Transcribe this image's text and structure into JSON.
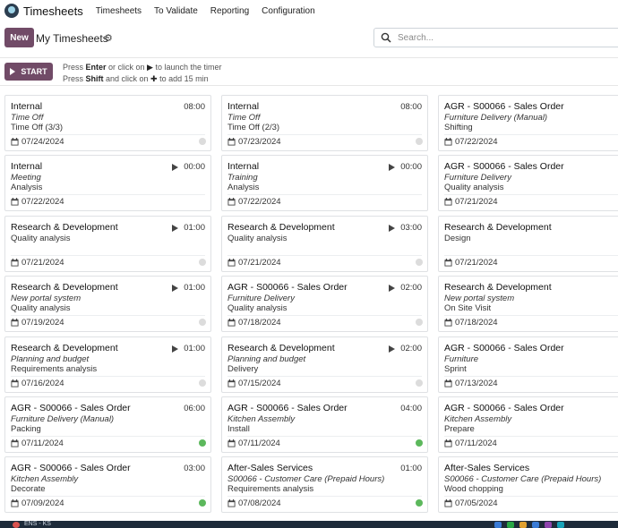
{
  "app": {
    "name": "Timesheets"
  },
  "menu": [
    "Timesheets",
    "To Validate",
    "Reporting",
    "Configuration"
  ],
  "control": {
    "new_label": "New",
    "breadcrumb": "My Timesheets",
    "search_placeholder": "Search..."
  },
  "timer": {
    "start_label": "START",
    "help1_a": "Press ",
    "help1_key": "Enter",
    "help1_b": " or click on ",
    "help1_c": " to launch the timer",
    "help2_a": "Press ",
    "help2_key": "Shift",
    "help2_b": " and click on ",
    "help2_c": " to add 15 min"
  },
  "cards": [
    [
      {
        "title": "Internal",
        "line2": "Time Off",
        "line3": "Time Off (3/3)",
        "date": "07/24/2024",
        "time": "08:00",
        "play": false,
        "status": "grey"
      },
      {
        "title": "Internal",
        "line2": "Meeting",
        "line3": "Analysis",
        "date": "07/22/2024",
        "time": "00:00",
        "play": true,
        "status": "none"
      },
      {
        "title": "Research & Development",
        "line2": "",
        "line3": "Quality analysis",
        "date": "07/21/2024",
        "time": "01:00",
        "play": true,
        "status": "grey"
      },
      {
        "title": "Research & Development",
        "line2": "New portal system",
        "line3": "Quality analysis",
        "date": "07/19/2024",
        "time": "01:00",
        "play": true,
        "status": "grey"
      },
      {
        "title": "Research & Development",
        "line2": "Planning and budget",
        "line3": "Requirements analysis",
        "date": "07/16/2024",
        "time": "01:00",
        "play": true,
        "status": "grey"
      },
      {
        "title": "AGR - S00066 - Sales Order",
        "line2": "Furniture Delivery (Manual)",
        "line3": "Packing",
        "date": "07/11/2024",
        "time": "06:00",
        "play": false,
        "status": "green"
      },
      {
        "title": "AGR - S00066 - Sales Order",
        "line2": "Kitchen Assembly",
        "line3": "Decorate",
        "date": "07/09/2024",
        "time": "03:00",
        "play": false,
        "status": "green"
      }
    ],
    [
      {
        "title": "Internal",
        "line2": "Time Off",
        "line3": "Time Off (2/3)",
        "date": "07/23/2024",
        "time": "08:00",
        "play": false,
        "status": "grey"
      },
      {
        "title": "Internal",
        "line2": "Training",
        "line3": "Analysis",
        "date": "07/22/2024",
        "time": "00:00",
        "play": true,
        "status": "none"
      },
      {
        "title": "Research & Development",
        "line2": "",
        "line3": "Quality analysis",
        "date": "07/21/2024",
        "time": "03:00",
        "play": true,
        "status": "grey"
      },
      {
        "title": "AGR - S00066 - Sales Order",
        "line2": "Furniture Delivery",
        "line3": "Quality analysis",
        "date": "07/18/2024",
        "time": "02:00",
        "play": true,
        "status": "grey"
      },
      {
        "title": "Research & Development",
        "line2": "Planning and budget",
        "line3": "Delivery",
        "date": "07/15/2024",
        "time": "02:00",
        "play": true,
        "status": "grey"
      },
      {
        "title": "AGR - S00066 - Sales Order",
        "line2": "Kitchen Assembly",
        "line3": "Install",
        "date": "07/11/2024",
        "time": "04:00",
        "play": false,
        "status": "green"
      },
      {
        "title": "After-Sales Services",
        "line2": "S00066 - Customer Care (Prepaid Hours)",
        "line3": "Requirements analysis",
        "date": "07/08/2024",
        "time": "01:00",
        "play": false,
        "status": "green"
      }
    ],
    [
      {
        "title": "AGR - S00066 - Sales Order",
        "line2": "Furniture Delivery (Manual)",
        "line3": "Shifting",
        "date": "07/22/2024",
        "time": "",
        "play": true,
        "status": "none"
      },
      {
        "title": "AGR - S00066 - Sales Order",
        "line2": "Furniture Delivery",
        "line3": "Quality analysis",
        "date": "07/21/2024",
        "time": "",
        "play": true,
        "status": "none"
      },
      {
        "title": "Research & Development",
        "line2": "",
        "line3": "Design",
        "date": "07/21/2024",
        "time": "",
        "play": true,
        "status": "none"
      },
      {
        "title": "Research & Development",
        "line2": "New portal system",
        "line3": "On Site Visit",
        "date": "07/18/2024",
        "time": "",
        "play": true,
        "status": "none"
      },
      {
        "title": "AGR - S00066 - Sales Order",
        "line2": "Furniture",
        "line3": "Sprint",
        "date": "07/13/2024",
        "time": "",
        "play": true,
        "status": "none"
      },
      {
        "title": "AGR - S00066 - Sales Order",
        "line2": "Kitchen Assembly",
        "line3": "Prepare",
        "date": "07/11/2024",
        "time": "",
        "play": false,
        "status": "none"
      },
      {
        "title": "After-Sales Services",
        "line2": "S00066 - Customer Care (Prepaid Hours)",
        "line3": "Wood chopping",
        "date": "07/05/2024",
        "time": "",
        "play": false,
        "status": "none"
      }
    ]
  ],
  "colors": {
    "brand": "#714b67",
    "done": "#5cb85c",
    "pending": "#dcdcdc"
  },
  "taskbar": {
    "label": "ENS - KS"
  }
}
